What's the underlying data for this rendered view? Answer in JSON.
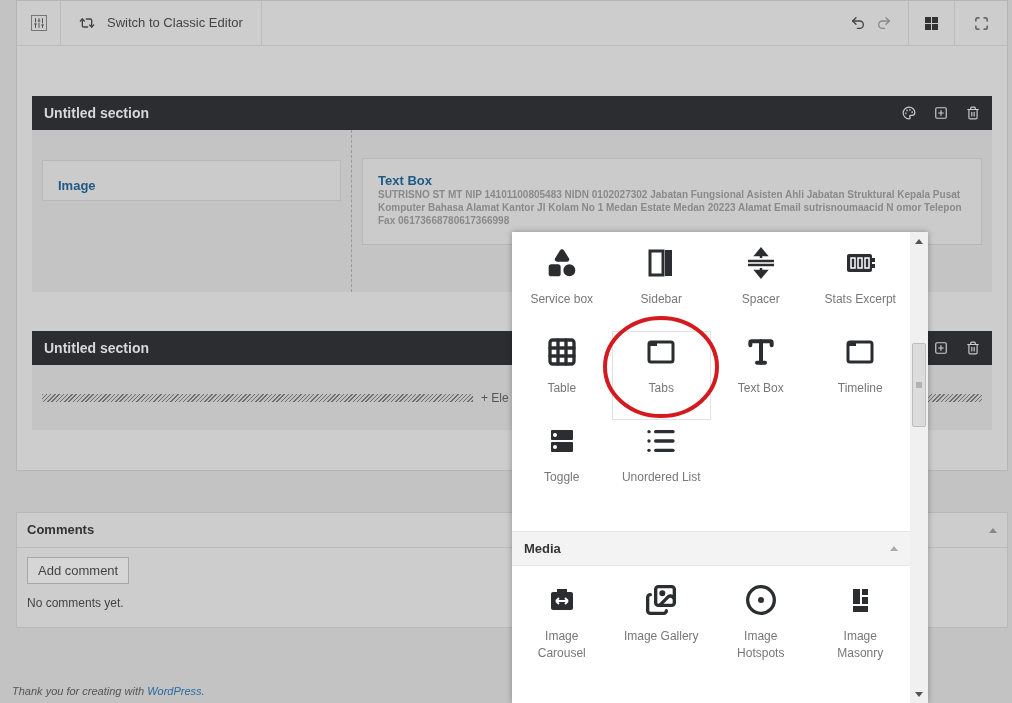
{
  "toolbar": {
    "switch_label": "Switch to Classic Editor"
  },
  "sections": [
    {
      "title": "Untitled section",
      "kind": "columns",
      "widgets": [
        {
          "title": "Image"
        },
        {
          "title": "Text Box",
          "body": "SUTRISNO ST MT NIP 14101100805483 NIDN 0102027302 Jabatan Fungsional Asisten Ahli Jabatan Struktural Kepala Pusat Komputer Bahasa Alamat Kantor Jl Kolam No 1 Medan Estate Medan 20223 Alamat Email sutrisnoumaacid N omor Telepon Fax 06173668780617366998"
        }
      ]
    },
    {
      "title": "Untitled section",
      "kind": "empty",
      "add_label": "+ Ele"
    }
  ],
  "comments": {
    "title": "Comments",
    "expanded": true,
    "button": "Add comment",
    "empty_text": "No comments yet."
  },
  "footer": {
    "text": "Thank you for creating with ",
    "link": "WordPress."
  },
  "widget_picker": {
    "groups": [
      {
        "items": [
          {
            "label": "Service box",
            "selected": false
          },
          {
            "label": "Sidebar",
            "selected": false
          },
          {
            "label": "Spacer",
            "selected": false
          },
          {
            "label": "Stats Excerpt",
            "selected": false
          },
          {
            "label": "Table",
            "selected": false
          },
          {
            "label": "Tabs",
            "selected": true,
            "circled": true
          },
          {
            "label": "Text Box",
            "selected": false
          },
          {
            "label": "Timeline",
            "selected": false
          },
          {
            "label": "Toggle",
            "selected": false
          },
          {
            "label": "Unordered List",
            "selected": false
          }
        ]
      },
      {
        "title": "Media",
        "expanded": true,
        "items": [
          {
            "label": "Image Carousel",
            "selected": false
          },
          {
            "label": "Image Gallery",
            "selected": false
          },
          {
            "label": "Image Hotspots",
            "selected": false
          },
          {
            "label": "Image Masonry",
            "selected": false
          }
        ]
      }
    ]
  }
}
